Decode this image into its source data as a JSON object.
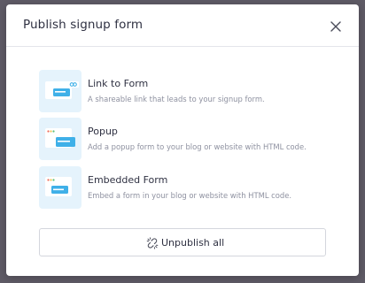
{
  "modal": {
    "title": "Publish signup form",
    "close_icon": "close-icon"
  },
  "options": [
    {
      "title": "Link to Form",
      "description": "A shareable link that leads to your signup form.",
      "icon": "link-form-icon"
    },
    {
      "title": "Popup",
      "description": "Add a popup form to your blog or website with HTML code.",
      "icon": "popup-form-icon"
    },
    {
      "title": "Embedded Form",
      "description": "Embed a form in your blog or website with HTML code.",
      "icon": "embedded-form-icon"
    }
  ],
  "unpublish": {
    "label": "Unpublish all",
    "icon": "unlink-icon"
  },
  "colors": {
    "backdrop": "#5f5b66",
    "thumb_bg": "#e5f3fc",
    "accent": "#3fb0e8",
    "text": "#2f3142",
    "muted_text": "#8e91a0"
  }
}
